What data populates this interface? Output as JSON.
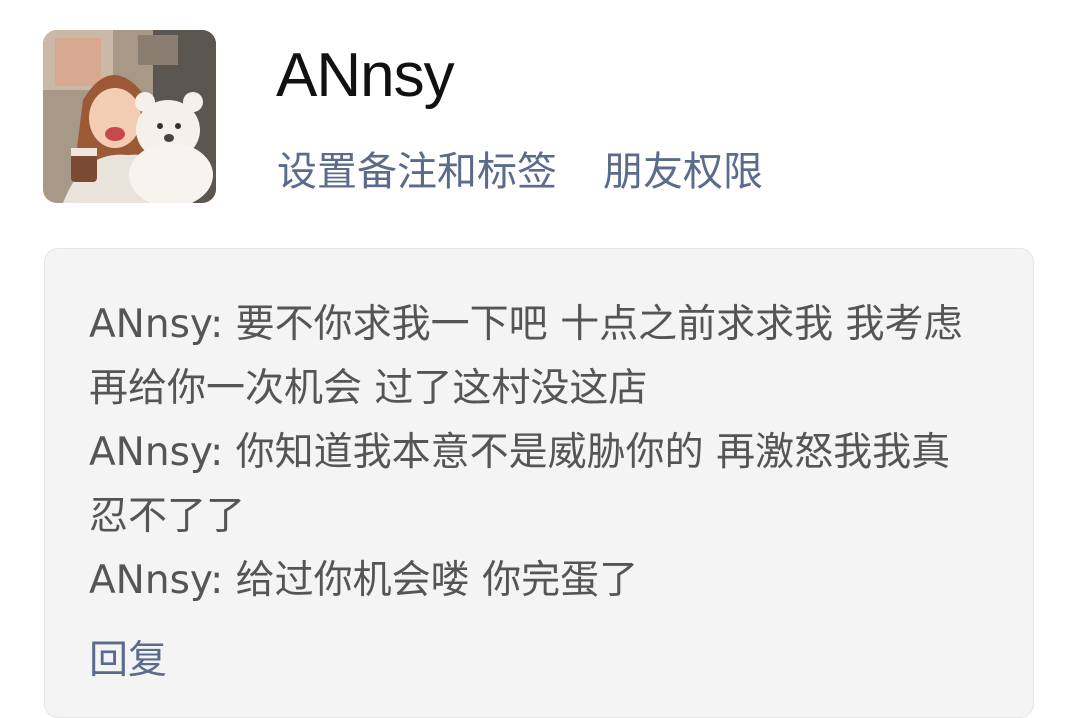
{
  "profile": {
    "nickname": "ANnsy",
    "avatar": "profile-photo-girl-with-teddy-bear",
    "links": [
      {
        "label": "设置备注和标签"
      },
      {
        "label": "朋友权限"
      }
    ]
  },
  "message_card": {
    "messages": [
      {
        "text": "ANnsy: 要不你求我一下吧 十点之前求求我 我考虑再给你一次机会 过了这村没这店"
      },
      {
        "text": "ANnsy: 你知道我本意不是威胁你的 再激怒我我真忍不了了"
      },
      {
        "text": "ANnsy: 给过你机会喽 你完蛋了"
      }
    ],
    "reply_label": "回复"
  },
  "colors": {
    "link": "#5a6b8c",
    "text": "#555555",
    "nickname": "#111111",
    "card_bg": "#f4f4f4"
  }
}
